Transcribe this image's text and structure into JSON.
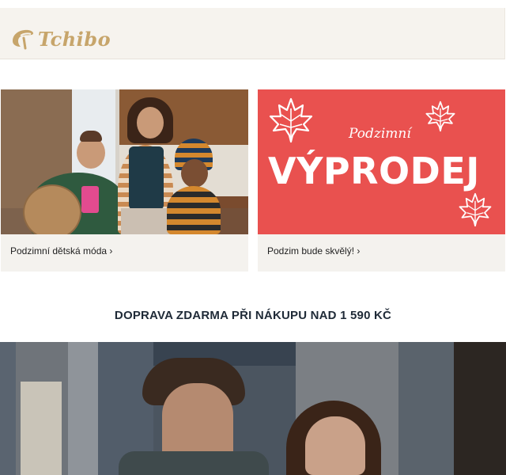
{
  "header": {
    "logo_text": "Tchibo"
  },
  "tiles": [
    {
      "caption": "Podzimní dětská móda ›"
    },
    {
      "caption": "Podzim bude skvělý! ›",
      "promo": {
        "subtitle": "Podzimní",
        "title": "VÝPRODEJ"
      }
    }
  ],
  "banner": {
    "text": "DOPRAVA ZDARMA PŘI NÁKUPU NAD 1 590 KČ"
  },
  "colors": {
    "brand_gold": "#c7a56b",
    "sale_red": "#e9514f",
    "header_bg": "#f6f3ee"
  }
}
